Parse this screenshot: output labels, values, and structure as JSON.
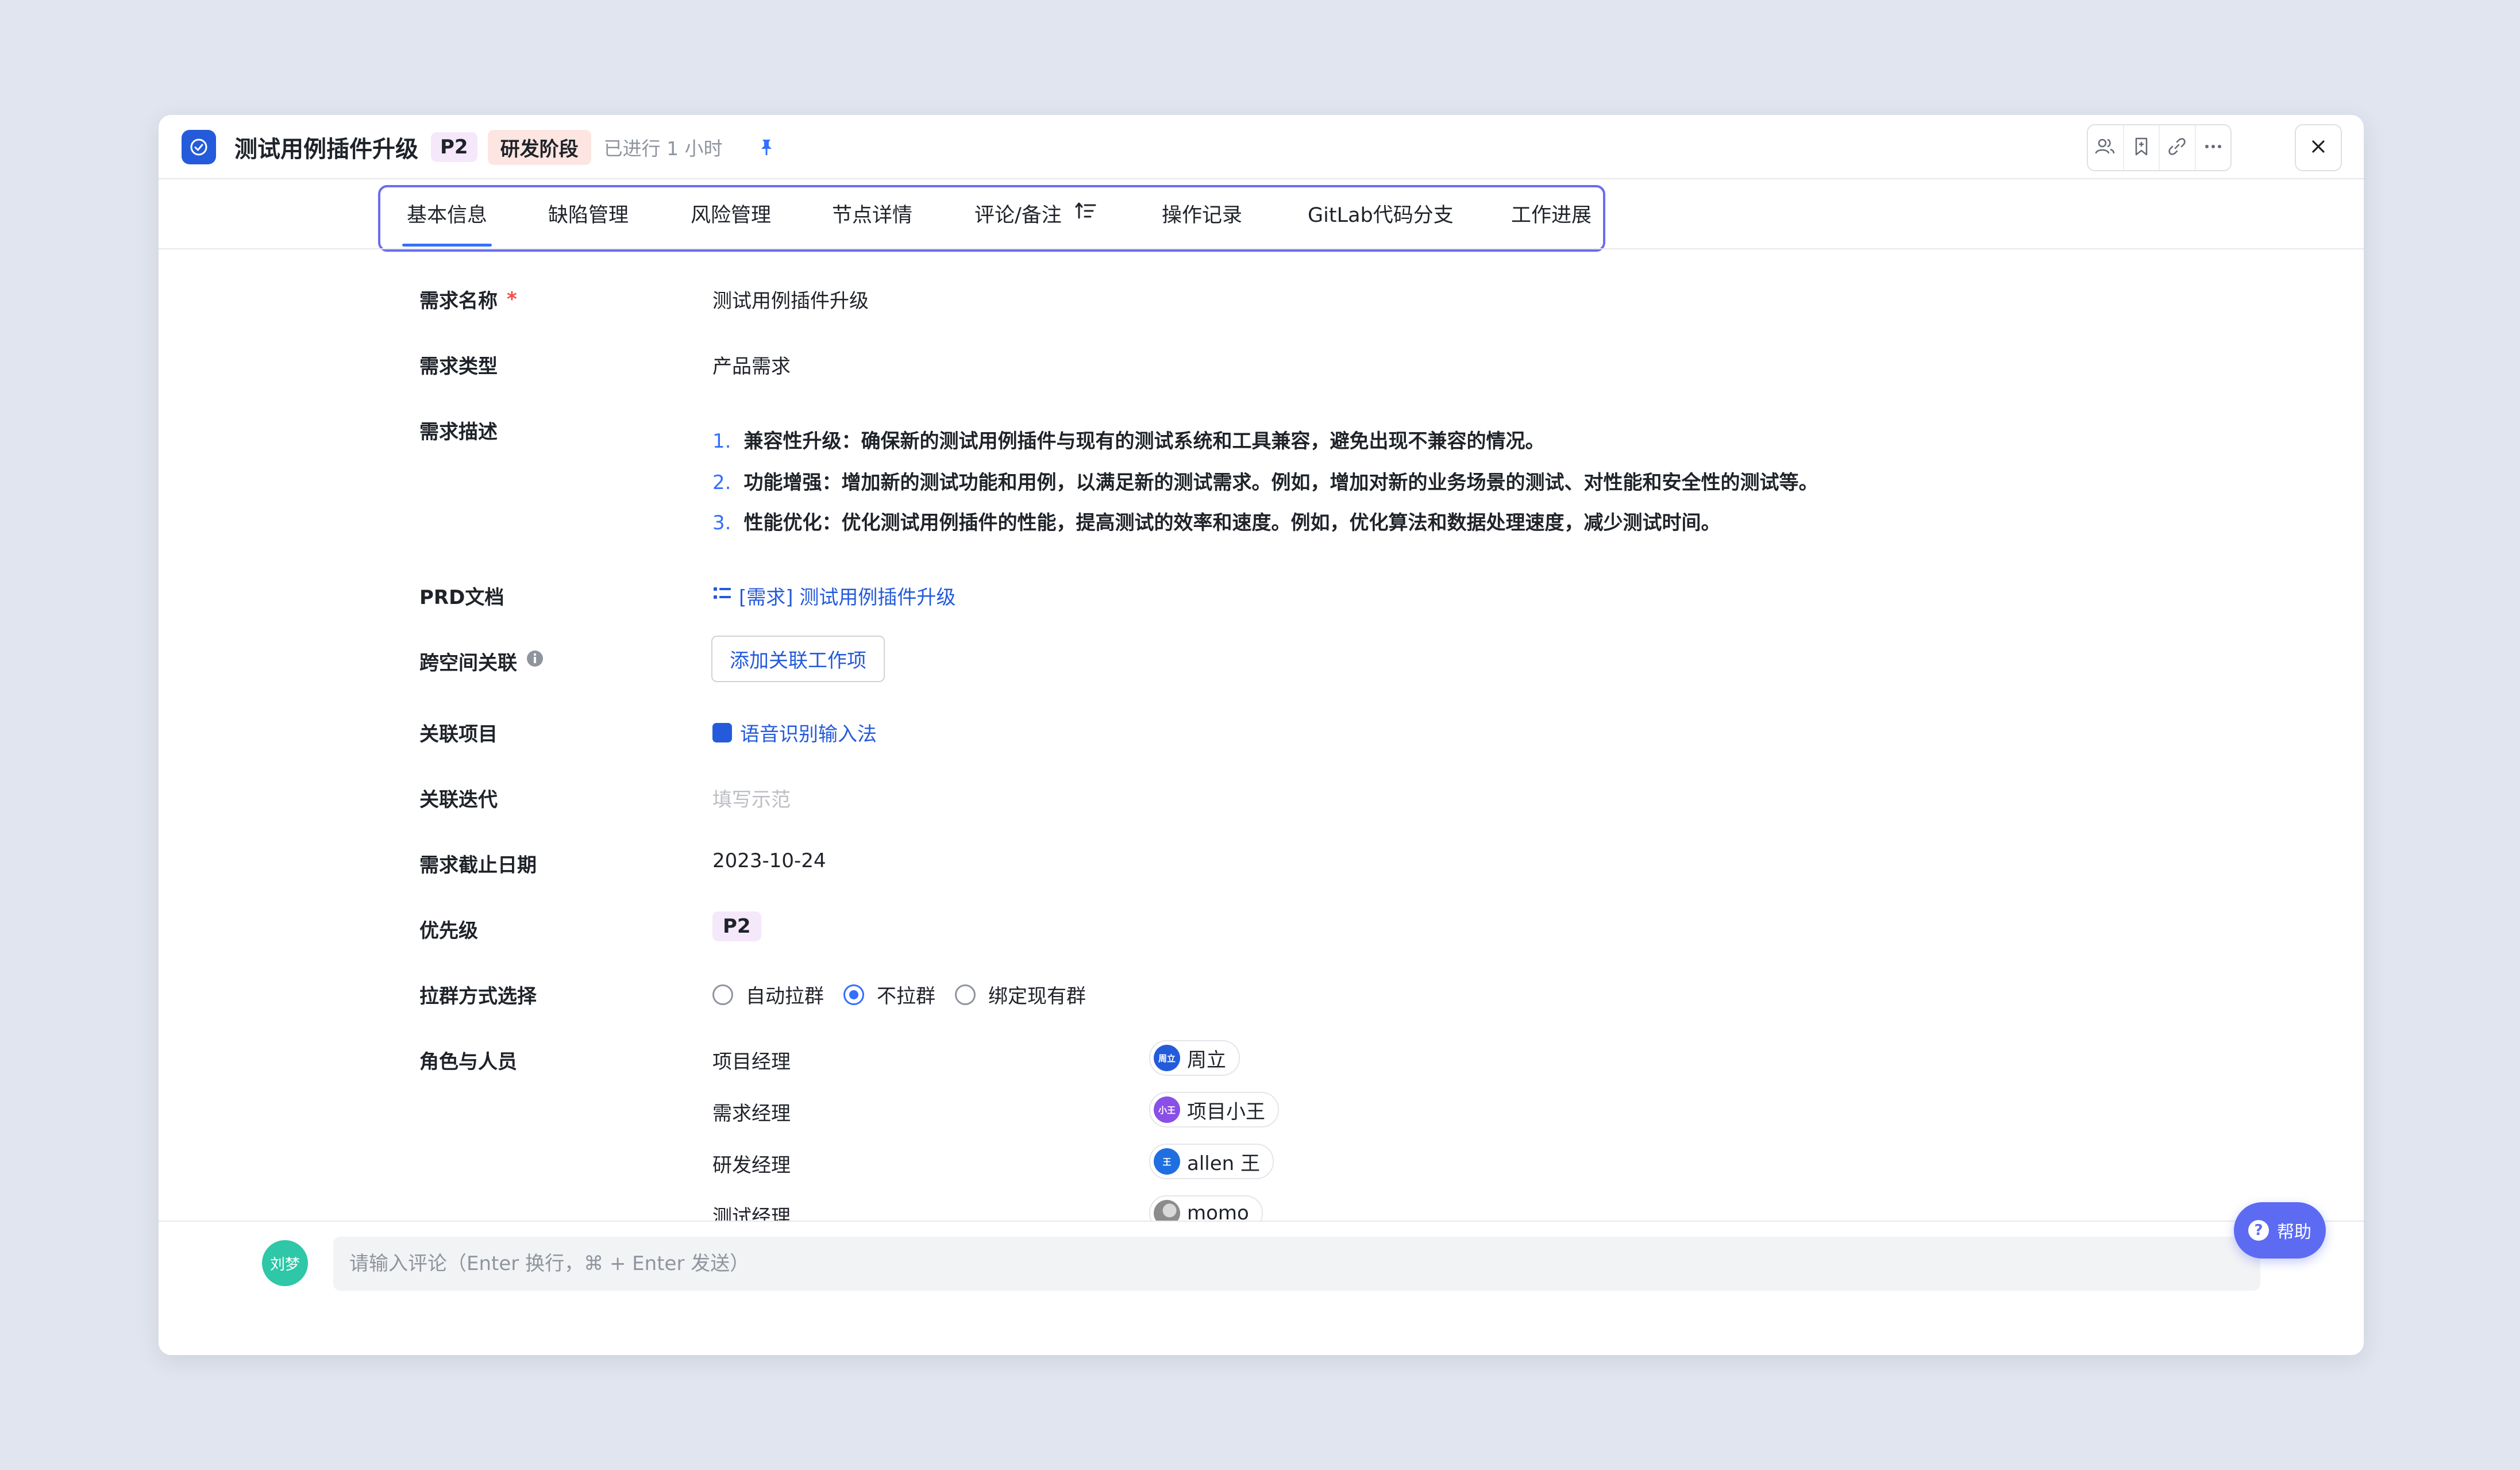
{
  "header": {
    "title": "测试用例插件升级",
    "priority": "P2",
    "stage": "研发阶段",
    "elapsed": "已进行 1 小时"
  },
  "tabs": [
    {
      "label": "基本信息",
      "active": true
    },
    {
      "label": "缺陷管理"
    },
    {
      "label": "风险管理"
    },
    {
      "label": "节点详情"
    },
    {
      "label": "评论/备注"
    },
    {
      "label": "操作记录"
    },
    {
      "label": "GitLab代码分支"
    },
    {
      "label": "工作进展"
    }
  ],
  "form": {
    "name": {
      "label": "需求名称",
      "required": "*",
      "value": "测试用例插件升级"
    },
    "type": {
      "label": "需求类型",
      "value": "产品需求"
    },
    "description": {
      "label": "需求描述",
      "items": [
        {
          "num": "1.",
          "text": "兼容性升级：确保新的测试用例插件与现有的测试系统和工具兼容，避免出现不兼容的情况。"
        },
        {
          "num": "2.",
          "text": "功能增强：增加新的测试功能和用例，以满足新的测试需求。例如，增加对新的业务场景的测试、对性能和安全性的测试等。"
        },
        {
          "num": "3.",
          "text": "性能优化：优化测试用例插件的性能，提高测试的效率和速度。例如，优化算法和数据处理速度，减少测试时间。"
        }
      ]
    },
    "prd": {
      "label": "PRD文档",
      "link": "[需求] 测试用例插件升级"
    },
    "cross_space": {
      "label": "跨空间关联",
      "button": "添加关联工作项"
    },
    "project": {
      "label": "关联项目",
      "value": "语音识别输入法"
    },
    "iteration": {
      "label": "关联迭代",
      "placeholder": "填写示范"
    },
    "deadline": {
      "label": "需求截止日期",
      "value": "2023-10-24"
    },
    "priority": {
      "label": "优先级",
      "value": "P2"
    },
    "group": {
      "label": "拉群方式选择",
      "options": [
        {
          "label": "自动拉群",
          "checked": false
        },
        {
          "label": "不拉群",
          "checked": true
        },
        {
          "label": "绑定现有群",
          "checked": false
        }
      ]
    },
    "roles": {
      "label": "角色与人员",
      "items": [
        {
          "role": "项目经理",
          "avatar": "周立",
          "person": "周立",
          "color": "#245bdb"
        },
        {
          "role": "需求经理",
          "avatar": "小王",
          "person": "项目小王",
          "color": "#8a4fe6"
        },
        {
          "role": "研发经理",
          "avatar": "王",
          "person": "allen 王",
          "color": "#1f6fe0"
        },
        {
          "role": "测试经理",
          "avatar": "",
          "person": "momo",
          "color": "#8c8c8c"
        }
      ]
    }
  },
  "footer": {
    "avatar": "刘梦",
    "comment_placeholder": "请输入评论（Enter 换行，⌘ + Enter 发送）"
  },
  "help": {
    "label": "帮助"
  }
}
